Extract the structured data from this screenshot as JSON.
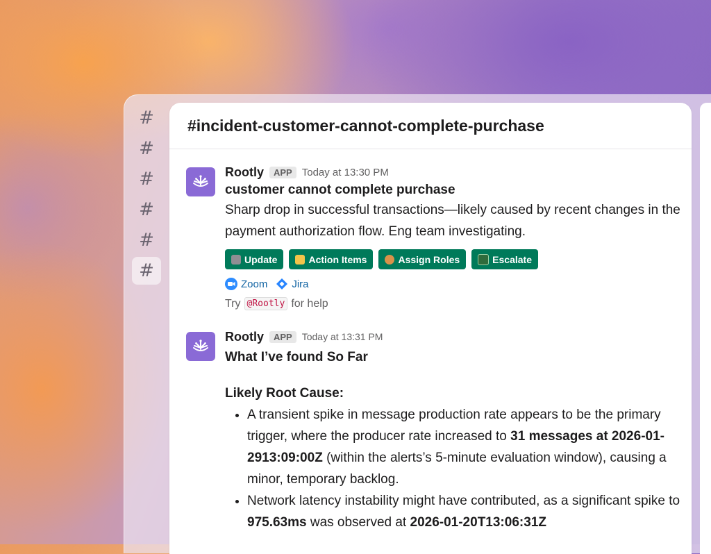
{
  "sidebar": {
    "channels": [
      {
        "icon": "#"
      },
      {
        "icon": "#"
      },
      {
        "icon": "#"
      },
      {
        "icon": "#"
      },
      {
        "icon": "#"
      },
      {
        "icon": "#",
        "active": true
      }
    ]
  },
  "channel": {
    "title": "#incident-customer-cannot-complete-purchase"
  },
  "messages": [
    {
      "sender": "Rootly",
      "badge": "APP",
      "time": "Today at 13:30 PM",
      "headline": "customer cannot complete purchase",
      "body": "Sharp drop in successful transactions—likely caused by recent changes in the payment authorization flow. Eng team investigating.",
      "actions": [
        {
          "label": "Update",
          "icon": "control-knobs-icon",
          "color": "#8e8e93"
        },
        {
          "label": "Action Items",
          "icon": "memo-icon",
          "color": "#f3c44a"
        },
        {
          "label": "Assign Roles",
          "icon": "person-icon",
          "color": "#d9924a"
        },
        {
          "label": "Escalate",
          "icon": "pager-icon",
          "color": "#2f6b3c"
        }
      ],
      "links": [
        {
          "label": "Zoom",
          "icon": "zoom-icon",
          "color": "#2d8cff"
        },
        {
          "label": "Jira",
          "icon": "jira-icon",
          "color": "#2684ff"
        }
      ],
      "hint": {
        "prefix": "Try",
        "code": "@Rootly",
        "suffix": "for help"
      }
    },
    {
      "sender": "Rootly",
      "badge": "APP",
      "time": "Today at 13:31 PM",
      "headline": "What I’ve found So Far",
      "section": "Likely Root Cause:",
      "bullets": [
        {
          "t1": "A transient spike in message production rate appears to be the primary trigger, where the producer rate increased to ",
          "b1": "31 messages at 2026-01-2913:09:00Z",
          "t2": " (within the alerts’s 5-minute evaluation window), causing a minor, temporary backlog."
        },
        {
          "t1": "Network latency instability might have contributed, as a significant spike to ",
          "b1": "975.63ms",
          "t2": " was observed at ",
          "b2": "2026-01-20T13:06:31Z"
        }
      ]
    }
  ],
  "colors": {
    "button": "#007a5a",
    "avatar": "#8a6ad6",
    "link": "#1264a3"
  }
}
